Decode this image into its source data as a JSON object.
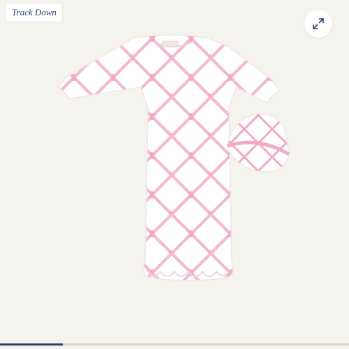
{
  "badge": {
    "label": "Track Down"
  },
  "toolbar": {
    "expand_icon": "expand-diagonal-icon"
  },
  "image": {
    "subject": "baby-gown-and-hat",
    "pattern_color": "#f2a9c8",
    "base_color": "#ffffff"
  },
  "carousel": {
    "progress": 0.18
  }
}
